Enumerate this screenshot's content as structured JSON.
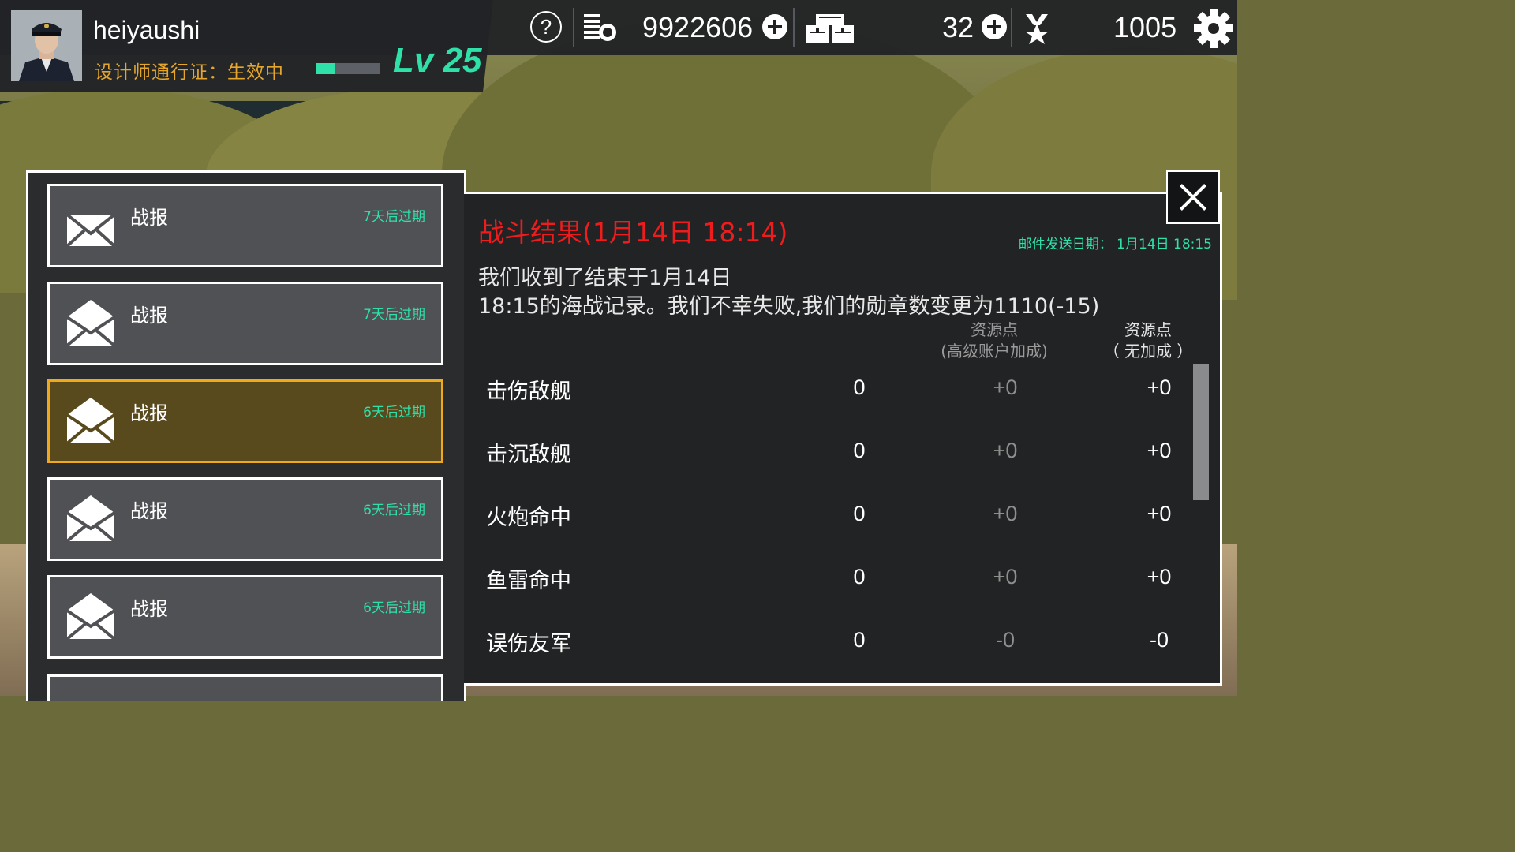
{
  "header": {
    "username": "heiyaushi",
    "pass_status": "设计师通行证：生效中",
    "level": "Lv 25",
    "xp_fraction": 0.3,
    "gold": "9922606",
    "crates": "32",
    "medals": "1005"
  },
  "mail_list": [
    {
      "title": "战报",
      "expire": "7天后过期",
      "read": false,
      "selected": false
    },
    {
      "title": "战报",
      "expire": "7天后过期",
      "read": true,
      "selected": false
    },
    {
      "title": "战报",
      "expire": "6天后过期",
      "read": true,
      "selected": true
    },
    {
      "title": "战报",
      "expire": "6天后过期",
      "read": true,
      "selected": false
    },
    {
      "title": "战报",
      "expire": "6天后过期",
      "read": true,
      "selected": false
    }
  ],
  "detail": {
    "title": "战斗结果(1月14日 18:14)",
    "send_date": "邮件发送日期： 1月14日 18:15",
    "message_line1": "我们收到了结束于1月14日",
    "message_line2": "18:15的海战记录。我们不幸失败,我们的勋章数变更为1110(-15)",
    "col_premium_line1": "资源点",
    "col_premium_line2": "(高级账户加成)",
    "col_base_line1": "资源点",
    "col_base_line2": "（ 无加成 ）",
    "rows": [
      {
        "label": "击伤敌舰",
        "count": "0",
        "premium": "+0",
        "base": "+0"
      },
      {
        "label": "击沉敌舰",
        "count": "0",
        "premium": "+0",
        "base": "+0"
      },
      {
        "label": "火炮命中",
        "count": "0",
        "premium": "+0",
        "base": "+0"
      },
      {
        "label": "鱼雷命中",
        "count": "0",
        "premium": "+0",
        "base": "+0"
      },
      {
        "label": "误伤友军",
        "count": "0",
        "premium": "-0",
        "base": "-0"
      }
    ]
  },
  "colors": {
    "accent_green": "#2fe0a9",
    "pass_gold": "#e5a62c",
    "title_red": "#ee1c1c",
    "selected_border": "#f0a81d"
  },
  "icons": {
    "help": "?",
    "gold": "coin-stack-icon",
    "crate": "crate-icon",
    "medal": "medal-icon",
    "settings": "gear-icon",
    "close": "close-icon",
    "mail_unread": "envelope-closed-icon",
    "mail_read": "envelope-open-icon"
  }
}
